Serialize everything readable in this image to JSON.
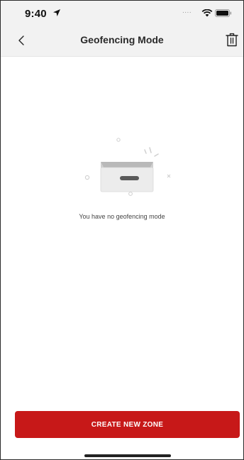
{
  "status_bar": {
    "time": "9:40",
    "signal_dots": "....",
    "location_icon": "location-arrow-icon",
    "wifi_icon": "wifi-icon",
    "battery_icon": "battery-icon"
  },
  "header": {
    "title": "Geofencing Mode",
    "back_icon": "chevron-left-icon",
    "delete_icon": "trash-icon"
  },
  "empty_state": {
    "icon": "empty-drawer-icon",
    "message": "You have no geofencing mode"
  },
  "actions": {
    "create_label": "CREATE NEW ZONE"
  },
  "colors": {
    "accent": "#c71818",
    "bar_background": "#f2f2f2"
  }
}
